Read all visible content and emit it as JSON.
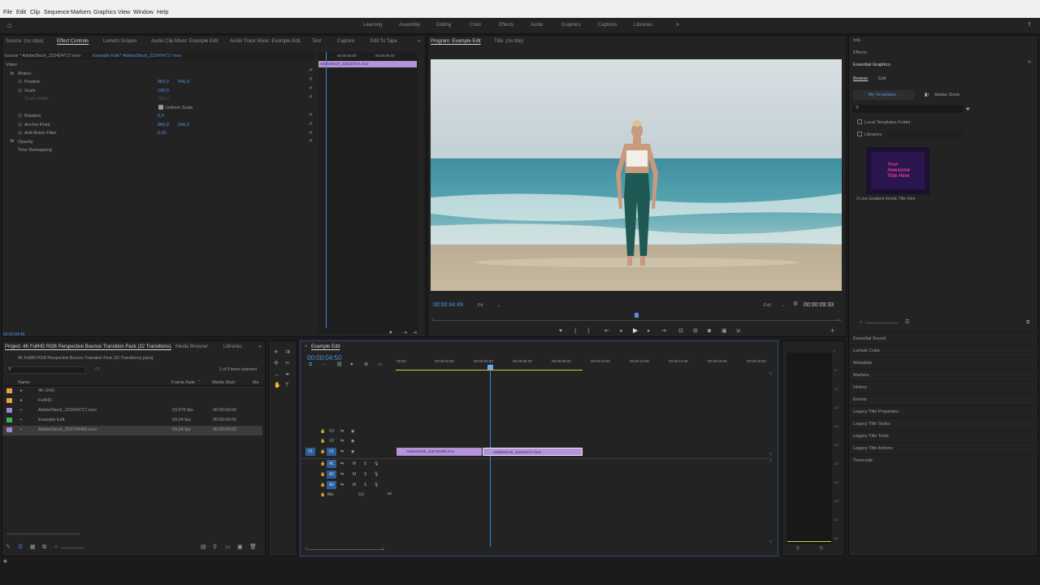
{
  "menu": [
    "File",
    "Edit",
    "Clip",
    "Sequence",
    "Markers",
    "Graphics",
    "View",
    "Window",
    "Help"
  ],
  "workspaces": [
    "Learning",
    "Assembly",
    "Editing",
    "Color",
    "Effects",
    "Audio",
    "Graphics",
    "Captions",
    "Libraries"
  ],
  "source_tabs": [
    "Source: (no clips)",
    "Effect Controls",
    "Lumetri Scopes",
    "Audio Clip Mixer: Example Edit",
    "Audio Track Mixer: Example Edit",
    "Text",
    "Capture",
    "Edit To Tape"
  ],
  "effect_controls": {
    "source_label": "Source * AdobeStock_222424717.mov",
    "sequence_label": "Example Edit * AdobeStock_222424717.mov",
    "section_video": "Video",
    "mini_times": [
      "00:00:05:00",
      "00:00:06:00"
    ],
    "mini_clip": "AdobeStock_222424717.mov",
    "motion": "Motion",
    "position": {
      "label": "Position",
      "x": "960,0",
      "y": "540,0"
    },
    "scale": {
      "label": "Scale",
      "value": "100,0"
    },
    "scale_width": {
      "label": "Scale Width",
      "value": "100,0"
    },
    "uniform_scale": "Uniform Scale",
    "rotation": {
      "label": "Rotation",
      "value": "0,0"
    },
    "anchor": {
      "label": "Anchor Point",
      "x": "960,0",
      "y": "540,0"
    },
    "flicker": {
      "label": "Anti-flicker Filter",
      "value": "0,00"
    },
    "opacity": "Opacity",
    "remap": "Time Remapping",
    "timecode": "00;00;04;49"
  },
  "program": {
    "tabs": [
      "Program: Example Edit",
      "Title: (no title)"
    ],
    "timecode": "00:00:04:49",
    "fit": "Fit",
    "quality": "Full",
    "duration": "00:00:09:33"
  },
  "project": {
    "tabs": [
      "Project: 4K FullHD RGB Perspective Bounce Transition Pack (32 Transitions)",
      "Media Browser",
      "Libraries"
    ],
    "file": "4K FullHD RGB Perspective Bounce Transition Pack (32 Transitions).prproj",
    "selected_count": "1 of 5 items selected",
    "columns": [
      "Name",
      "Frame Rate",
      "Media Start",
      "Me"
    ],
    "items": [
      {
        "name": "4K UHD",
        "rate": "",
        "start": "",
        "color": "#e8a33c"
      },
      {
        "name": "FullHD",
        "rate": "",
        "start": "",
        "color": "#e8a33c"
      },
      {
        "name": "AdobeStock_222424717.mov",
        "rate": "23,976 fps",
        "start": "00:00:00:00",
        "color": "#9b87d6"
      },
      {
        "name": "Example Edit",
        "rate": "59,94 fps",
        "start": "00:00:00:00",
        "color": "#3fb34f"
      },
      {
        "name": "AdobeStock_315704495.mov",
        "rate": "59,94 fps",
        "start": "00:00:00:00",
        "color": "#9b87d6"
      }
    ]
  },
  "timeline": {
    "tab": "Example Edit",
    "timecode": "00:00:04:50",
    "ruler": [
      ":00:00",
      "00:00:02:00",
      "00:00:04:00",
      "00:00:06:00",
      "00:00:08:00",
      "00:00:10:00",
      "00:00:12:00",
      "00:00:14:00",
      "00:00:16:00",
      "00:00:18:00"
    ],
    "video_tracks": [
      "V3",
      "V2",
      "V1"
    ],
    "audio_tracks": [
      "A1",
      "A2",
      "A3"
    ],
    "mix": "Mix",
    "mix_value": "0,0",
    "clip1": "AdobeStock_315704495.mov",
    "clip2": "AdobeStock_222424717.mov",
    "m": "M",
    "s": "S"
  },
  "right": {
    "info": "Info",
    "effects": "Effects",
    "essential_graphics": "Essential Graphics",
    "browse": "Browse",
    "edit": "Edit",
    "my_templates": "My Templates",
    "adobe_stock": "Adobe Stock",
    "local_templates": "Local Templates Folder",
    "libraries": "Libraries",
    "template_text": "Your Awesome Title Here",
    "template_name": "3 Line Gradient Kinetic Title Intro",
    "list": [
      "Essential Sound",
      "Lumetri Color",
      "Metadata",
      "Markers",
      "History",
      "Events",
      "Legacy Title Properties",
      "Legacy Title Styles",
      "Legacy Title Tools",
      "Legacy Title Actions",
      "Timecode"
    ]
  },
  "meter_ticks": [
    "0",
    "-6",
    "-12",
    "-18",
    "-24",
    "-30",
    "-36",
    "-42",
    "-48",
    "-54",
    "dB"
  ],
  "meter_s": "S"
}
